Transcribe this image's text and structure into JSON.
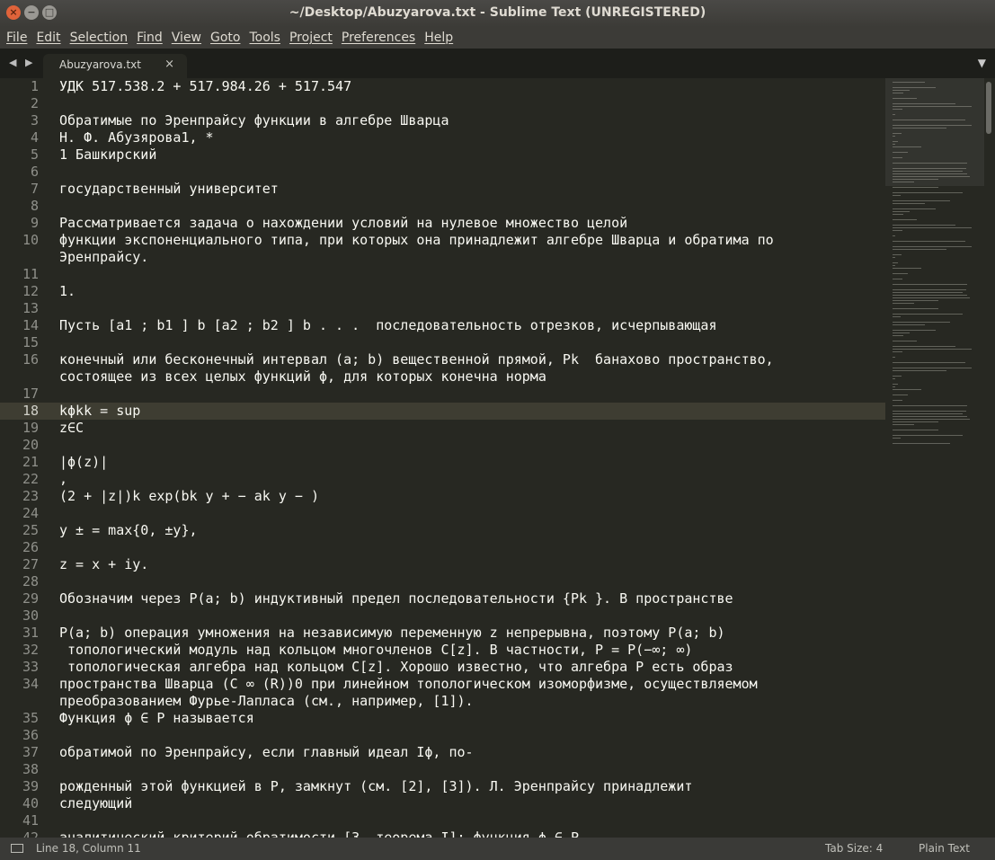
{
  "window": {
    "title": "~/Desktop/Abuzyarova.txt - Sublime Text (UNREGISTERED)",
    "close_glyph": "×",
    "min_glyph": "−",
    "max_glyph": "□"
  },
  "menu": [
    "File",
    "Edit",
    "Selection",
    "Find",
    "View",
    "Goto",
    "Tools",
    "Project",
    "Preferences",
    "Help"
  ],
  "tabs": {
    "nav_arrows": "◀ ▶",
    "active_label": "Abuzyarova.txt",
    "close_glyph": "×",
    "dropdown_glyph": "▼"
  },
  "editor": {
    "active_line": 18,
    "lines": [
      {
        "n": "1",
        "text": "УДК 517.538.2 + 517.984.26 + 517.547"
      },
      {
        "n": "2",
        "text": ""
      },
      {
        "n": "3",
        "text": "Обратимые по Эренпрайсу функции в алгебре Шварца"
      },
      {
        "n": "4",
        "text": "Н. Ф. Абузярова1, *"
      },
      {
        "n": "5",
        "text": "1 Башкирский"
      },
      {
        "n": "6",
        "text": ""
      },
      {
        "n": "7",
        "text": "государственный университет"
      },
      {
        "n": "8",
        "text": ""
      },
      {
        "n": "9",
        "text": "Рассматривается задача о нахождении условий на нулевое множество целой"
      },
      {
        "n": "10",
        "text": "функции экспоненциального типа, при которых она принадлежит алгебре Шварца и обратима по"
      },
      {
        "n": "",
        "text": "Эренпрайсу."
      },
      {
        "n": "11",
        "text": ""
      },
      {
        "n": "12",
        "text": "1."
      },
      {
        "n": "13",
        "text": ""
      },
      {
        "n": "14",
        "text": "Пусть [a1 ; b1 ] b [a2 ; b2 ] b . . .  последовательность отрезков, исчерпывающая"
      },
      {
        "n": "15",
        "text": ""
      },
      {
        "n": "16",
        "text": "конечный или бесконечный интервал (a; b) вещественной прямой, Pk  банахово пространство,"
      },
      {
        "n": "",
        "text": "состоящее из всех целых функций ϕ, для которых конечна норма"
      },
      {
        "n": "17",
        "text": ""
      },
      {
        "n": "18",
        "text": "kϕkk = sup"
      },
      {
        "n": "19",
        "text": "z∈C"
      },
      {
        "n": "20",
        "text": ""
      },
      {
        "n": "21",
        "text": "|ϕ(z)|"
      },
      {
        "n": "22",
        "text": ","
      },
      {
        "n": "23",
        "text": "(2 + |z|)k exp(bk y + − ak y − )"
      },
      {
        "n": "24",
        "text": ""
      },
      {
        "n": "25",
        "text": "y ± = max{0, ±y},"
      },
      {
        "n": "26",
        "text": ""
      },
      {
        "n": "27",
        "text": "z = x + iy."
      },
      {
        "n": "28",
        "text": ""
      },
      {
        "n": "29",
        "text": "Обозначим через P(a; b) индуктивный предел последовательности {Pk }. В пространстве"
      },
      {
        "n": "30",
        "text": ""
      },
      {
        "n": "31",
        "text": "P(a; b) операция умножения на независимую переменную z непрерывна, поэтому P(a; b)"
      },
      {
        "n": "32",
        "text": " топологический модуль над кольцом многочленов C[z]. В частности, P = P(−∞; ∞)"
      },
      {
        "n": "33",
        "text": " топологическая алгебра над кольцом C[z]. Хорошо известно, что алгебра P есть образ"
      },
      {
        "n": "34",
        "text": "пространства Шварца (C ∞ (R))0 при линейном топологическом изоморфизме, осуществляемом"
      },
      {
        "n": "",
        "text": "преобразованием Фурье-Лапласа (см., например, [1])."
      },
      {
        "n": "35",
        "text": "Функция ϕ ∈ P называется"
      },
      {
        "n": "36",
        "text": ""
      },
      {
        "n": "37",
        "text": "обратимой по Эренпрайсу, если главный идеал Iϕ, по-"
      },
      {
        "n": "38",
        "text": ""
      },
      {
        "n": "39",
        "text": "рожденный этой функцией в P, замкнут (см. [2], [3]). Л. Эренпрайсу принадлежит"
      },
      {
        "n": "40",
        "text": "следующий"
      },
      {
        "n": "41",
        "text": ""
      },
      {
        "n": "42",
        "text": "аналитический критерий обратимости [3, теорема I]: функция ϕ ∈ P"
      }
    ]
  },
  "status": {
    "position": "Line 18, Column 11",
    "tab_size": "Tab Size: 4",
    "syntax": "Plain Text"
  }
}
